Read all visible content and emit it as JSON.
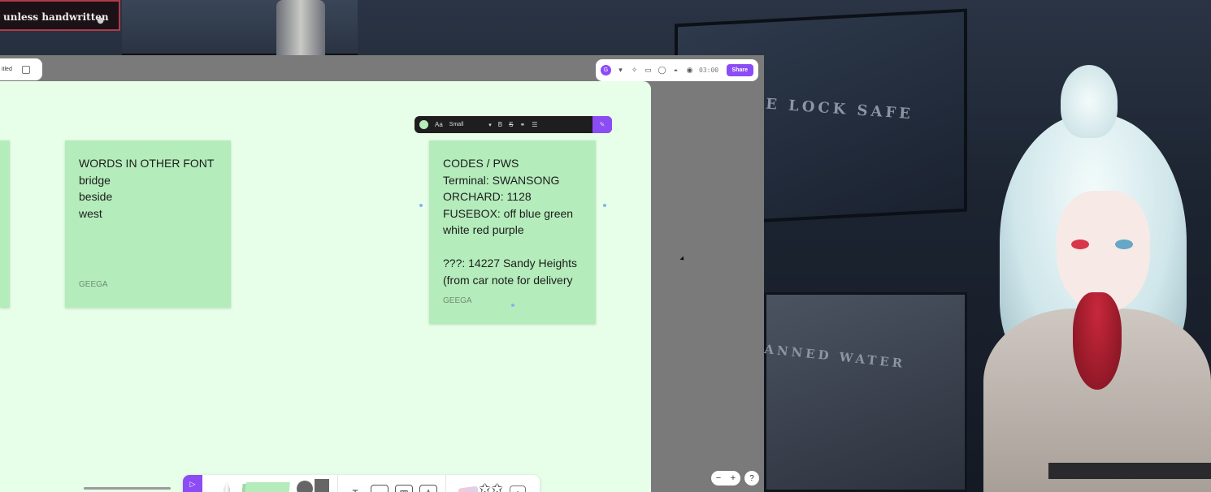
{
  "caption": {
    "text": "unless handwritten"
  },
  "top_left_pill": {
    "title": "itled"
  },
  "top_right_bar": {
    "avatar_initial": "G",
    "timer": "03:00",
    "share_label": "Share"
  },
  "format_toolbar": {
    "font_icon": "Aa",
    "size_value": "Small",
    "bold": "B",
    "strike": "S",
    "color": "#b5edbb"
  },
  "stickies": {
    "words": {
      "lines": [
        "WORDS IN OTHER FONT",
        "bridge",
        "beside",
        "west"
      ],
      "author": "GEEGA"
    },
    "codes": {
      "lines": [
        "CODES / PWS",
        "Terminal: SWANSONG",
        "ORCHARD: 1128",
        "FUSEBOX: off blue green",
        "white red purple",
        "",
        "???: 14227 Sandy Heights",
        "(from car note for delivery"
      ],
      "author": "GEEGA"
    }
  },
  "bottom_toolbar": {
    "text_tool": "T",
    "plus": "+"
  },
  "zoom": {
    "minus": "−",
    "plus": "+"
  },
  "help": "?",
  "scene": {
    "safe_label": "E LOCK SAFE",
    "water_label": "ANNED WATER"
  },
  "colors": {
    "accent": "#8c4cf5",
    "canvas": "#e7fee8",
    "sticky": "#b4ecbb"
  }
}
